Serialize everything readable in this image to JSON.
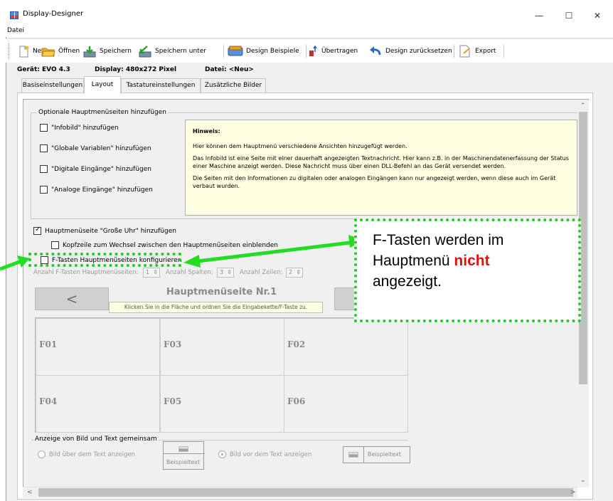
{
  "window": {
    "title": "Display-Designer",
    "min_glyph": "—",
    "max_glyph": "☐",
    "close_glyph": "✕"
  },
  "menu": {
    "datei": "Datei"
  },
  "toolbar": {
    "neu": "Neu",
    "oeffnen": "Öffnen",
    "speichern": "Speichern",
    "speichern_unter": "Speichern unter",
    "design_beispiele": "Design Beispiele",
    "uebertragen": "Übertragen",
    "design_zuruecksetzen": "Design zurücksetzen",
    "export": "Export"
  },
  "info": {
    "geraet": "Gerät: EVO 4.3",
    "display": "Display: 480x272 Pixel",
    "datei": "Datei: <Neu>"
  },
  "tabs": [
    "Basiseinstellungen",
    "Layout",
    "Tastatureinstellungen",
    "Zusätzliche Bilder"
  ],
  "optional_group": {
    "label": "Optionale Hauptmenüseiten hinzufügen",
    "items": [
      "\"Infobild\" hinzufügen",
      "\"Globale Variablen\" hinzufügen",
      "\"Digitale Eingänge\" hinzufügen",
      "\"Analoge Eingänge\" hinzufügen"
    ]
  },
  "hint": {
    "title": "Hinweis:",
    "p1": "Hier können dem Hauptmenü verschiedene Ansichten hinzugefügt werden.",
    "p2": "Das Infobild ist eine Seite mit einer dauerhaft angezeigten Textnachricht. Hier kann z.B. in der Maschinendatenerfassung der Status einer Maschine anzeigt werden. Diese Nachricht muss über einen DLL-Befehl an das Gerät versendet werden.",
    "p3": "Die Seiten mit den Informationen zu digitalen oder analogen Eingängen kann nur angezeigt werden, wenn diese auch im Gerät verbaut wurden."
  },
  "clock": {
    "label": "Hauptmenüseite \"Große Uhr\" hinzufügen",
    "checked": true,
    "header_toggle": "Kopfzeile zum Wechsel zwischen den Hauptmenüseiten einblenden"
  },
  "fkeys": {
    "configure_label": "F-Tasten Hauptmenüseiten konfigurieren",
    "count_label": "Anzahl F-Tasten Hauptmenüseiten:",
    "count_value": "1",
    "cols_label": "Anzahl Spalten:",
    "cols_value": "3",
    "rows_label": "Anzahl Zeilen:",
    "rows_value": "2",
    "prev_glyph": "<",
    "page_title": "Hauptmenüseite Nr.1",
    "page_hint": "Klicken Sie in die Fläche und ordnen Sie die Eingabekette/F-Taste zu.",
    "cells": [
      "F01",
      "F03",
      "F02",
      "F04",
      "F05",
      "F06"
    ]
  },
  "image_text_group": {
    "label": "Anzeige von Bild und Text gemeinsam",
    "option_above": "Bild über dem Text anzeigen",
    "option_before": "Bild vor dem Text anzeigen",
    "sample_text": "Beispieltext"
  },
  "callout": {
    "line1": "F-Tasten werden im",
    "line2_pre": "Hauptmenü ",
    "line2_red": "nicht",
    "line3": "angezeigt."
  },
  "colors": {
    "highlight_green": "#22cc22",
    "emphasis_red": "#e01010",
    "hint_yellow": "#ffffe1"
  }
}
